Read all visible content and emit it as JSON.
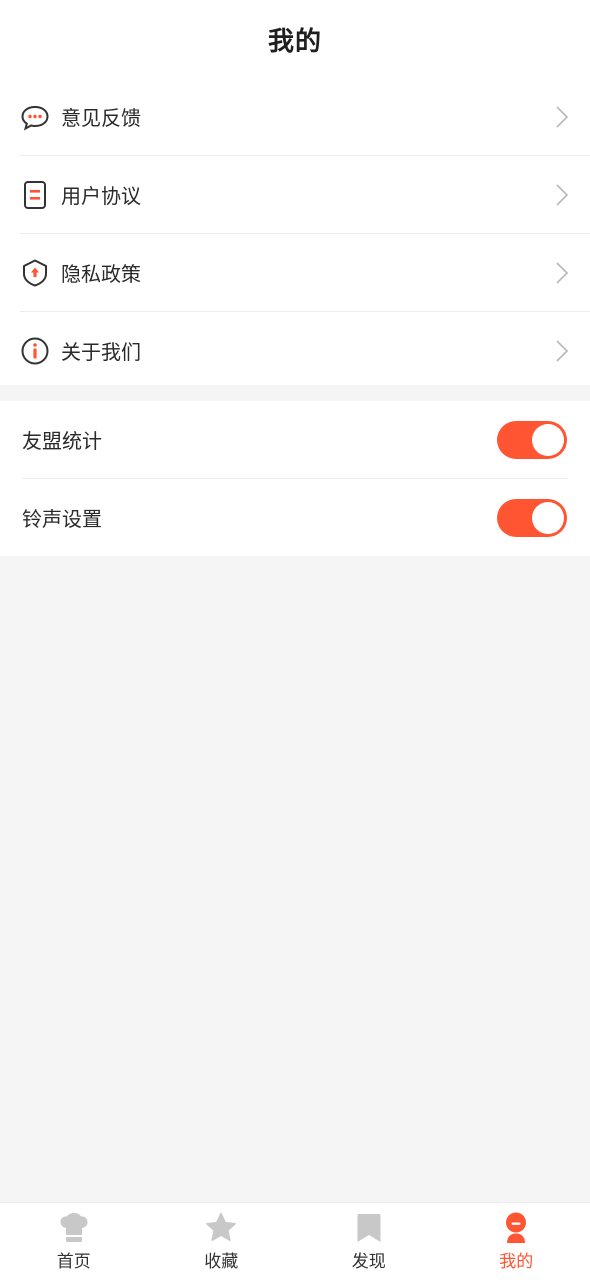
{
  "header": {
    "title": "我的"
  },
  "menu": {
    "items": [
      {
        "label": "意见反馈",
        "icon": "feedback-chat-icon"
      },
      {
        "label": "用户协议",
        "icon": "document-icon"
      },
      {
        "label": "隐私政策",
        "icon": "shield-icon"
      },
      {
        "label": "关于我们",
        "icon": "info-icon"
      }
    ]
  },
  "settings": {
    "items": [
      {
        "label": "友盟统计",
        "on": true
      },
      {
        "label": "铃声设置",
        "on": true
      }
    ]
  },
  "tabbar": {
    "items": [
      {
        "label": "首页",
        "icon": "chef-hat-icon",
        "active": false
      },
      {
        "label": "收藏",
        "icon": "star-icon",
        "active": false
      },
      {
        "label": "发现",
        "icon": "bookmark-icon",
        "active": false
      },
      {
        "label": "我的",
        "icon": "profile-icon",
        "active": true
      }
    ]
  },
  "colors": {
    "accent": "#ff5533",
    "icon_gray": "#c8c8c8",
    "text": "#2a2a2a"
  }
}
